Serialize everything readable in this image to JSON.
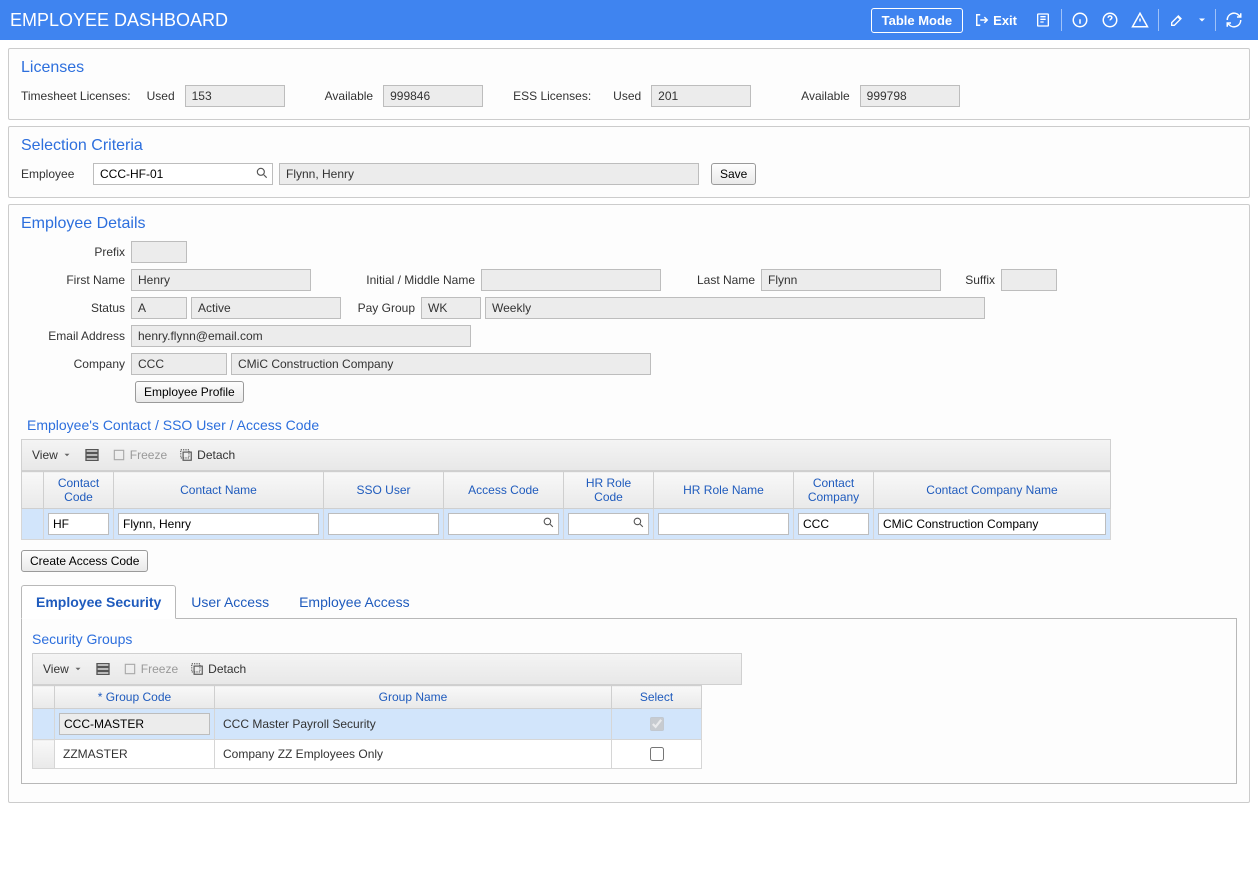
{
  "header": {
    "title": "EMPLOYEE DASHBOARD",
    "table_mode": "Table Mode",
    "exit": "Exit"
  },
  "licenses": {
    "title": "Licenses",
    "ts_label": "Timesheet Licenses:",
    "used_label": "Used",
    "available_label": "Available",
    "ts_used": "153",
    "ts_available": "999846",
    "ess_label": "ESS Licenses:",
    "ess_used": "201",
    "ess_available": "999798"
  },
  "criteria": {
    "title": "Selection Criteria",
    "employee_label": "Employee",
    "employee_code": "CCC-HF-01",
    "employee_name": "Flynn, Henry",
    "save": "Save"
  },
  "details": {
    "title": "Employee Details",
    "prefix_label": "Prefix",
    "prefix": "",
    "first_name_label": "First Name",
    "first_name": "Henry",
    "middle_label": "Initial / Middle Name",
    "middle": "",
    "last_name_label": "Last Name",
    "last_name": "Flynn",
    "suffix_label": "Suffix",
    "suffix": "",
    "status_label": "Status",
    "status_code": "A",
    "status_desc": "Active",
    "paygroup_label": "Pay Group",
    "paygroup_code": "WK",
    "paygroup_desc": "Weekly",
    "email_label": "Email Address",
    "email": "henry.flynn@email.com",
    "company_label": "Company",
    "company_code": "CCC",
    "company_name": "CMiC Construction Company",
    "profile_btn": "Employee Profile"
  },
  "contact_section": {
    "title": "Employee's Contact / SSO User / Access Code",
    "toolbar": {
      "view": "View",
      "freeze": "Freeze",
      "detach": "Detach"
    },
    "columns": {
      "contact_code": "Contact Code",
      "contact_name": "Contact Name",
      "sso_user": "SSO User",
      "access_code": "Access Code",
      "hr_role_code": "HR Role Code",
      "hr_role_name": "HR Role Name",
      "contact_company": "Contact Company",
      "contact_company_name": "Contact Company Name"
    },
    "rows": [
      {
        "contact_code": "HF",
        "contact_name": "Flynn, Henry",
        "sso_user": "",
        "access_code": "",
        "hr_role_code": "",
        "hr_role_name": "",
        "contact_company": "CCC",
        "contact_company_name": "CMiC Construction Company"
      }
    ],
    "create_access_code": "Create Access Code"
  },
  "tabs": {
    "employee_security": "Employee Security",
    "user_access": "User Access",
    "employee_access": "Employee Access"
  },
  "security": {
    "title": "Security Groups",
    "toolbar": {
      "view": "View",
      "freeze": "Freeze",
      "detach": "Detach"
    },
    "columns": {
      "group_code": "* Group Code",
      "group_name": "Group Name",
      "select": "Select"
    },
    "rows": [
      {
        "group_code": "CCC-MASTER",
        "group_name": "CCC Master Payroll Security",
        "selected": true,
        "active": true
      },
      {
        "group_code": "ZZMASTER",
        "group_name": "Company ZZ Employees Only",
        "selected": false,
        "active": false
      }
    ]
  }
}
